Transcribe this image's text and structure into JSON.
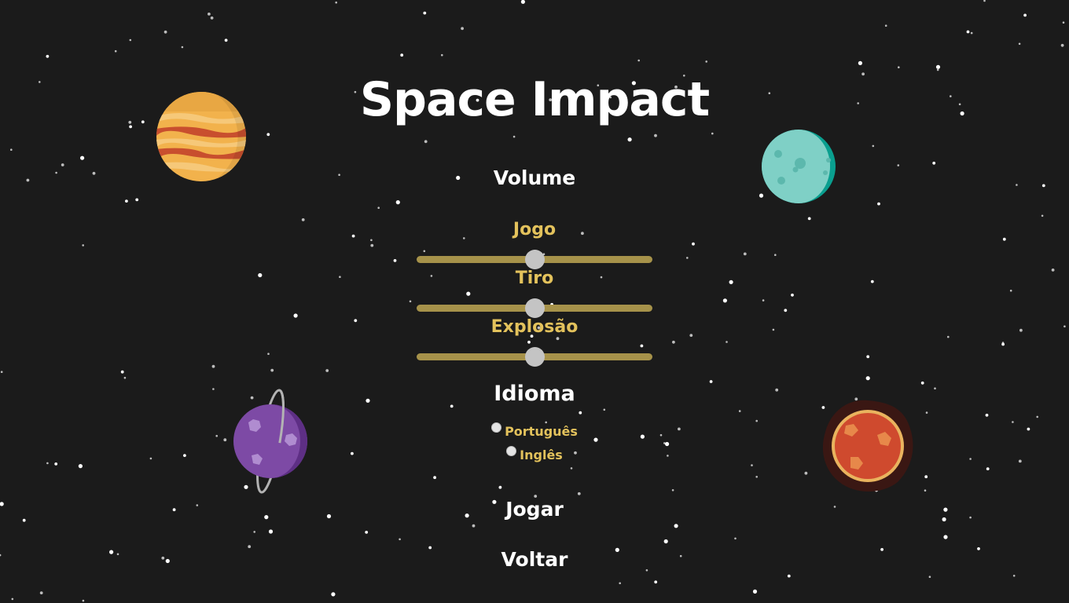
{
  "title": "Space Impact",
  "volume": {
    "heading": "Volume",
    "sliders": [
      {
        "label": "Jogo",
        "value": 0.5
      },
      {
        "label": "Tiro",
        "value": 0.5
      },
      {
        "label": "Explosão",
        "value": 0.5
      }
    ]
  },
  "language": {
    "heading": "Idioma",
    "options": [
      {
        "label": "Português",
        "selected": false
      },
      {
        "label": "Inglês",
        "selected": false
      }
    ]
  },
  "buttons": {
    "play": "Jogar",
    "back": "Voltar"
  },
  "colors": {
    "background": "#1b1b1b",
    "gold": "#e3c25c",
    "slider_track": "#a6924a",
    "thumb": "#c4c4c4"
  },
  "icons": [
    "jupiter-planet-icon",
    "moon-planet-icon",
    "purple-ringed-planet-icon",
    "mars-planet-icon"
  ]
}
